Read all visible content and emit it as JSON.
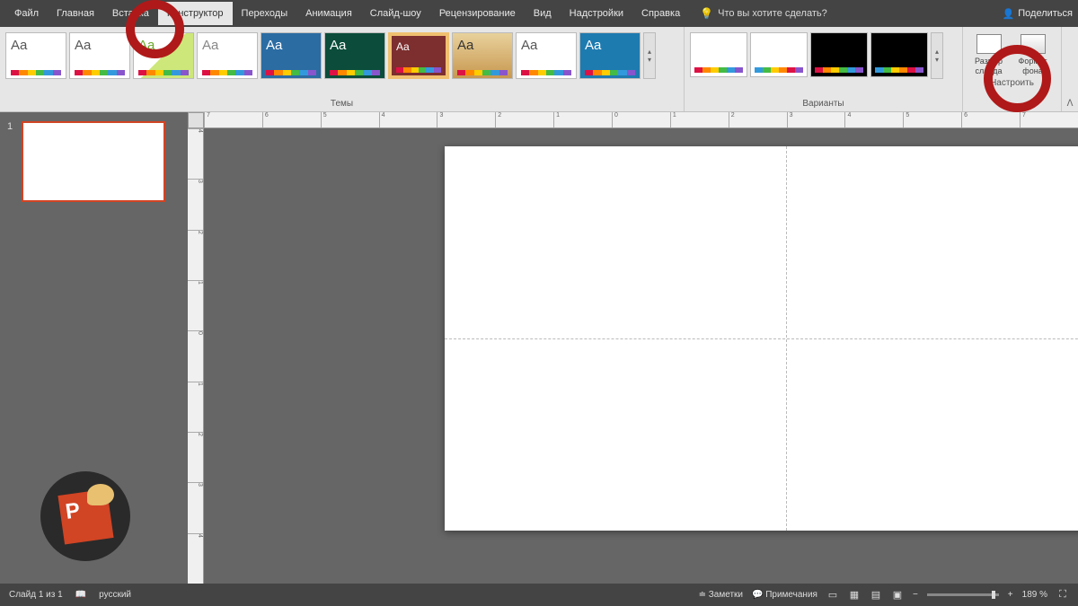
{
  "menu": {
    "items": [
      "Файл",
      "Главная",
      "Вставка",
      "Конструктор",
      "Переходы",
      "Анимация",
      "Слайд-шоу",
      "Рецензирование",
      "Вид",
      "Надстройки",
      "Справка"
    ],
    "active": 3,
    "tellme": "Что вы хотите сделать?",
    "share": "Поделиться"
  },
  "ribbon": {
    "themes_label": "Темы",
    "themes": [
      {
        "aa": "Aa"
      },
      {
        "aa": "Aa"
      },
      {
        "aa": "Aa"
      },
      {
        "aa": "Aa"
      },
      {
        "aa": "Aa"
      },
      {
        "aa": "Aa"
      },
      {
        "aa": "Aa"
      },
      {
        "aa": "Aa"
      },
      {
        "aa": "Aa"
      },
      {
        "aa": "Aa"
      }
    ],
    "variants_label": "Варианты",
    "custom_label": "Настроить",
    "size_label": "Размер слайда",
    "format_label": "Формат фона"
  },
  "ruler": {
    "h": [
      "7",
      "6",
      "5",
      "4",
      "3",
      "2",
      "1",
      "0",
      "1",
      "2",
      "3",
      "4",
      "5",
      "6",
      "7"
    ],
    "v": [
      "4",
      "3",
      "2",
      "1",
      "0",
      "1",
      "2",
      "3",
      "4"
    ]
  },
  "thumbs": {
    "num1": "1"
  },
  "status": {
    "slide": "Слайд 1 из 1",
    "lang": "русский",
    "notes": "Заметки",
    "comments": "Примечания",
    "zoom": "189 %"
  }
}
